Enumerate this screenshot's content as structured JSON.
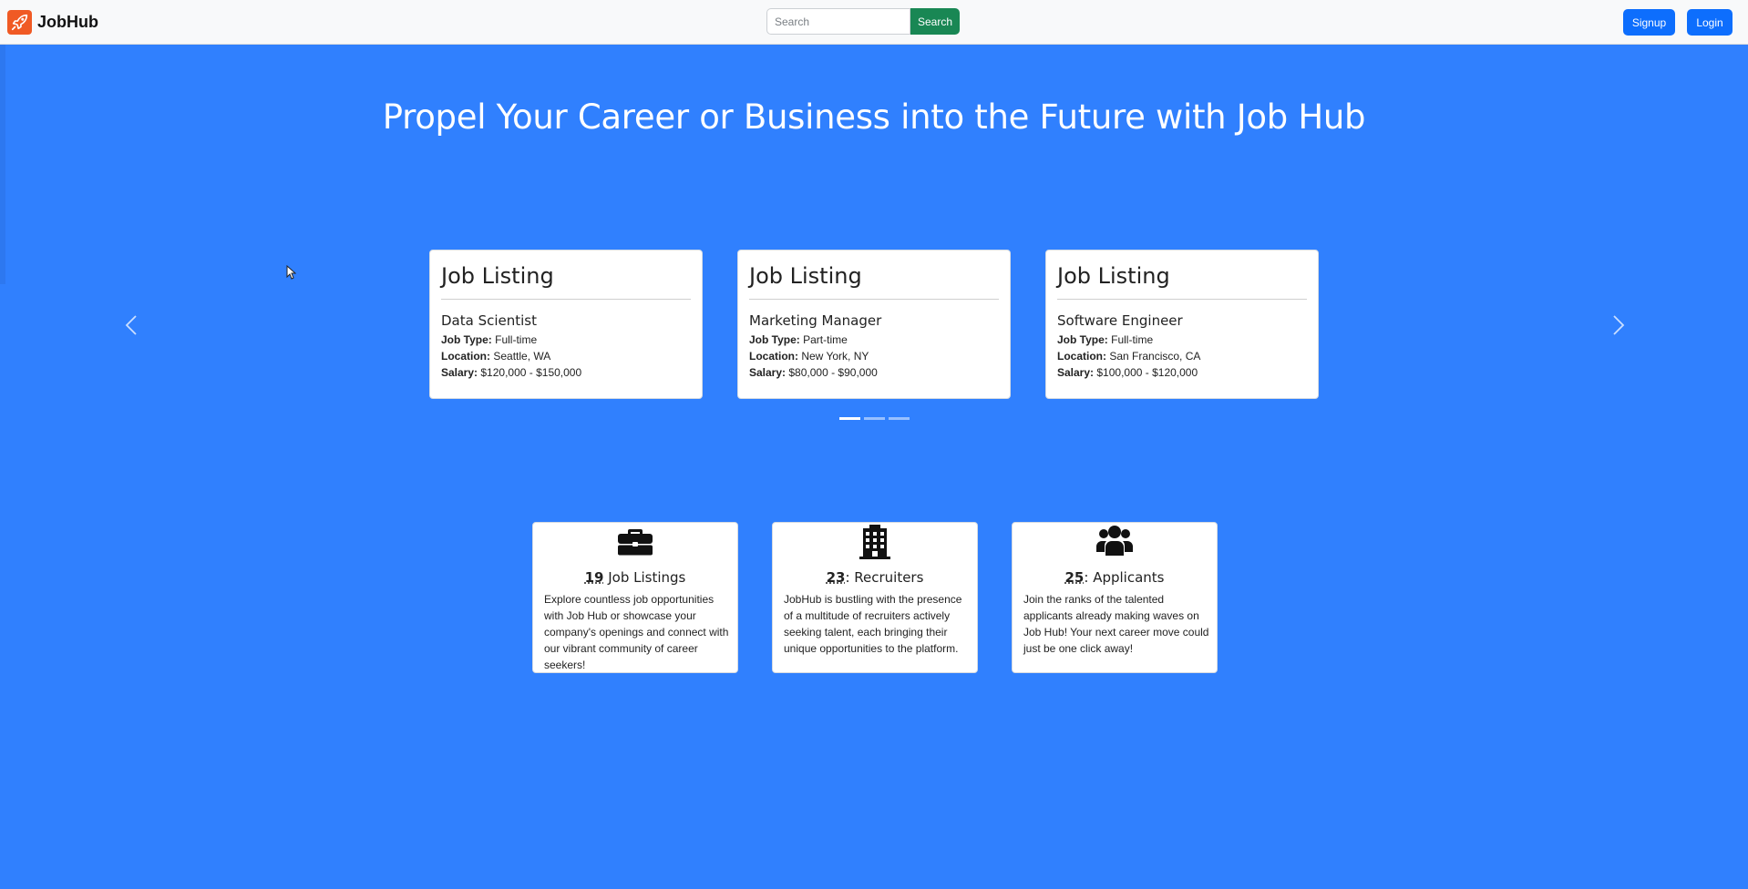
{
  "navbar": {
    "brand": "JobHub",
    "search_placeholder": "Search",
    "search_label": "Search",
    "signup_label": "Signup",
    "login_label": "Login"
  },
  "hero": {
    "title": "Propel Your Career or Business into the Future with Job Hub"
  },
  "carousel": {
    "active_index": 0,
    "indicator_count": 3,
    "cards": [
      {
        "heading": "Job Listing",
        "title": "Data Scientist",
        "job_type_label": "Job Type:",
        "job_type": "Full-time",
        "location_label": "Location:",
        "location": "Seattle, WA",
        "salary_label": "Salary:",
        "salary": "$120,000 - $150,000"
      },
      {
        "heading": "Job Listing",
        "title": "Marketing Manager",
        "job_type_label": "Job Type:",
        "job_type": "Part-time",
        "location_label": "Location:",
        "location": "New York, NY",
        "salary_label": "Salary:",
        "salary": "$80,000 - $90,000"
      },
      {
        "heading": "Job Listing",
        "title": "Software Engineer",
        "job_type_label": "Job Type:",
        "job_type": "Full-time",
        "location_label": "Location:",
        "location": "San Francisco, CA",
        "salary_label": "Salary:",
        "salary": "$100,000 - $120,000"
      }
    ]
  },
  "stats": [
    {
      "icon": "briefcase-icon",
      "count": "19",
      "label": " Job Listings",
      "description": "Explore countless job opportunities with Job Hub or showcase your company's openings and connect with our vibrant community of career seekers!"
    },
    {
      "icon": "building-icon",
      "count": "23",
      "label": ": Recruiters",
      "description": "JobHub is bustling with the presence of a multitude of recruiters actively seeking talent, each bringing their unique opportunities to the platform."
    },
    {
      "icon": "users-icon",
      "count": "25",
      "label": ": Applicants",
      "description": "Join the ranks of the talented applicants already making waves on Job Hub! Your next career move could just be one click away!"
    }
  ],
  "colors": {
    "background": "#3080fe",
    "primary_button": "#0d6efd",
    "search_button": "#198754",
    "brand_logo": "#f05a24"
  }
}
